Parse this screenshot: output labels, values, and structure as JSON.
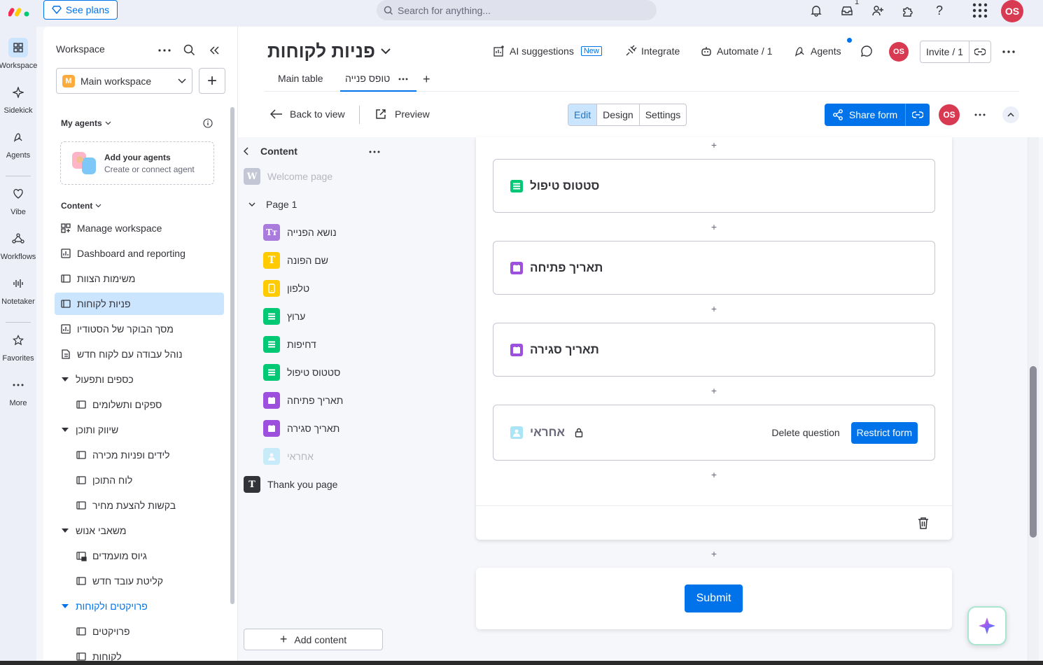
{
  "topbar": {
    "see_plans": "See plans",
    "search_placeholder": "Search for anything...",
    "inbox_count": "1",
    "user_initials": "OS"
  },
  "rail": {
    "items": [
      {
        "label": "Workspace",
        "icon": "grid-icon"
      },
      {
        "label": "Sidekick",
        "icon": "sparkle-icon"
      },
      {
        "label": "Agents",
        "icon": "agents-icon"
      },
      {
        "label": "Vibe",
        "icon": "heart-icon"
      },
      {
        "label": "Workflows",
        "icon": "workflows-icon"
      },
      {
        "label": "Notetaker",
        "icon": "waveform-icon"
      },
      {
        "label": "Favorites",
        "icon": "star-icon"
      },
      {
        "label": "More",
        "icon": "more-icon"
      }
    ]
  },
  "sidebar": {
    "title": "Workspace",
    "workspace_badge": "M",
    "workspace_name": "Main workspace",
    "my_agents": "My agents",
    "agent_card_title": "Add your agents",
    "agent_card_sub": "Create or connect agent",
    "content_label": "Content",
    "items": [
      {
        "label": "Manage workspace",
        "icon": "manage-icon"
      },
      {
        "label": "Dashboard and reporting",
        "icon": "dashboard-icon"
      },
      {
        "label": "משימות הצוות",
        "icon": "board-icon"
      },
      {
        "label": "פניות לקוחות",
        "icon": "board-icon"
      },
      {
        "label": "מסך הבוקר של הסטודיו",
        "icon": "dashboard-icon"
      },
      {
        "label": "נוהל עבודה עם לקוח חדש",
        "icon": "doc-icon"
      },
      {
        "label": "כספים ותפעול",
        "icon": "folder"
      },
      {
        "label": "ספקים ותשלומים",
        "icon": "board-icon"
      },
      {
        "label": "שיווק ותוכן",
        "icon": "folder"
      },
      {
        "label": "לידים ופניות מכירה",
        "icon": "board-icon"
      },
      {
        "label": "לוח התוכן",
        "icon": "board-icon"
      },
      {
        "label": "בקשות להצעת מחיר",
        "icon": "board-icon"
      },
      {
        "label": "משאבי אנוש",
        "icon": "folder"
      },
      {
        "label": "גיוס מועמדים",
        "icon": "board-locked-icon"
      },
      {
        "label": "קליטת עובד חדש",
        "icon": "board-icon"
      },
      {
        "label": "פרויקטים ולקוחות",
        "icon": "folder"
      },
      {
        "label": "פרויקטים",
        "icon": "board-icon"
      },
      {
        "label": "לקוחות",
        "icon": "board-icon"
      }
    ]
  },
  "board": {
    "title": "פניות לקוחות",
    "ai_suggestions": "AI suggestions",
    "new_badge": "New",
    "integrate": "Integrate",
    "automate": "Automate / 1",
    "agents": "Agents",
    "invite": "Invite / 1",
    "avatar": "OS",
    "tabs": [
      "Main table",
      "טופס פנייה"
    ]
  },
  "form_toolbar": {
    "back": "Back to view",
    "preview": "Preview",
    "segments": [
      "Edit",
      "Design",
      "Settings"
    ],
    "share": "Share form",
    "avatar": "OS"
  },
  "content_panel": {
    "title": "Content",
    "welcome": "Welcome page",
    "page": "Page 1",
    "questions": [
      {
        "label": "נושא הפנייה",
        "glyph": "Tт",
        "color": "#a97bdd"
      },
      {
        "label": "שם הפונה",
        "glyph": "T",
        "color": "#ffcb00"
      },
      {
        "label": "טלפון",
        "glyph": "phone",
        "color": "#ffcb00"
      },
      {
        "label": "ערוץ",
        "glyph": "status",
        "color": "#00c875"
      },
      {
        "label": "דחיפות",
        "glyph": "status",
        "color": "#00c875"
      },
      {
        "label": "סטטוס טיפול",
        "glyph": "status",
        "color": "#00c875"
      },
      {
        "label": "תאריך פתיחה",
        "glyph": "date",
        "color": "#9d50dd"
      },
      {
        "label": "תאריך סגירה",
        "glyph": "date",
        "color": "#9d50dd"
      },
      {
        "label": "אחראי",
        "glyph": "person",
        "color": "#a9e4f7"
      }
    ],
    "thank_you": "Thank you page",
    "add_content": "Add content"
  },
  "form": {
    "cards": [
      {
        "label": "סטטוס טיפול",
        "type": "status",
        "color": "#00c875"
      },
      {
        "label": "תאריך פתיחה",
        "type": "date",
        "color": "#9d50dd"
      },
      {
        "label": "תאריך סגירה",
        "type": "date",
        "color": "#9d50dd"
      },
      {
        "label": "אחראי",
        "type": "person",
        "color": "#a9e4f7"
      }
    ],
    "delete_question": "Delete question",
    "restrict_form": "Restrict form",
    "submit": "Submit"
  }
}
